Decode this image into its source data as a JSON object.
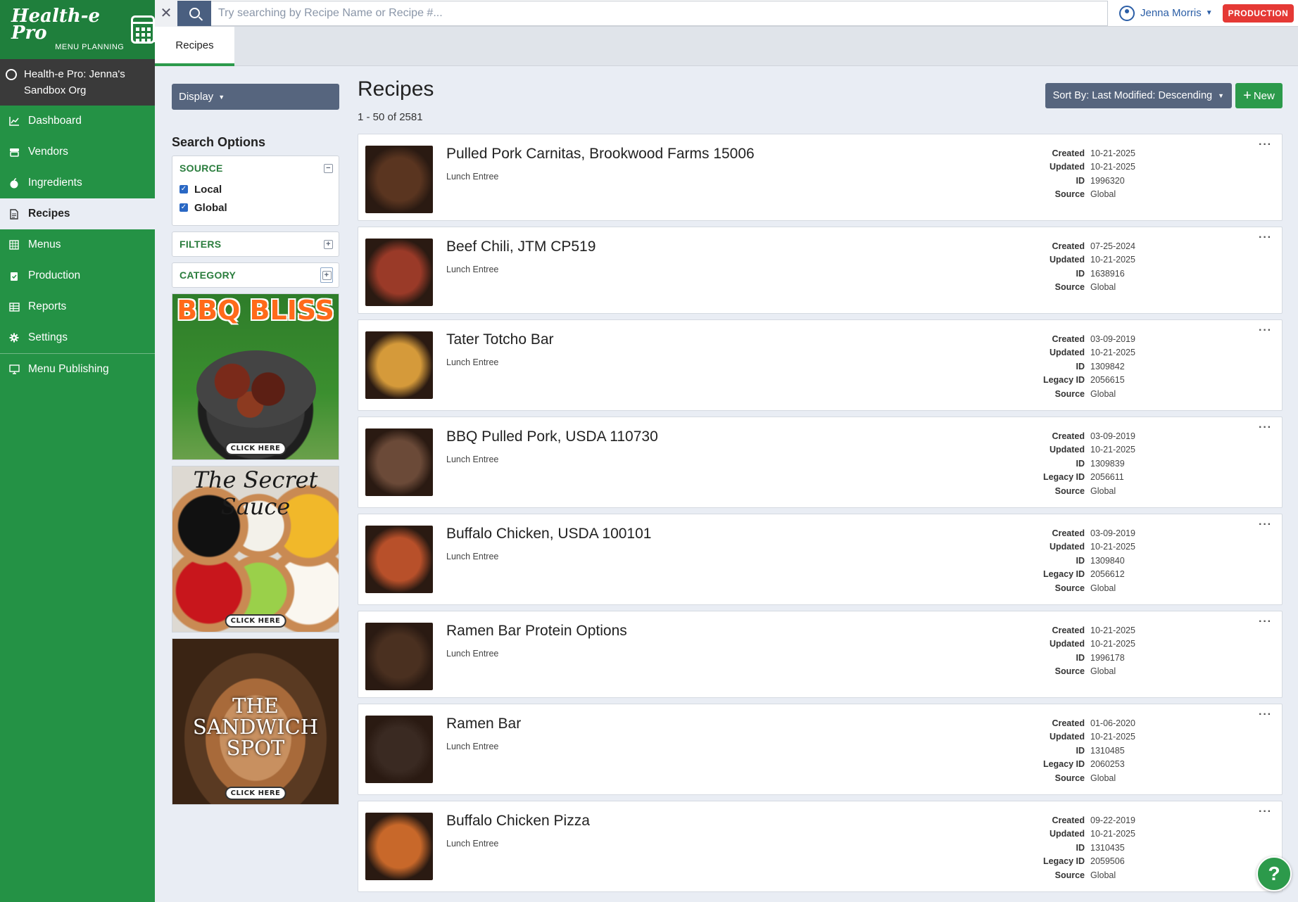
{
  "app": {
    "logo_title": "Health-e Pro",
    "logo_subtitle": "MENU PLANNING",
    "org_name": "Health-e Pro: Jenna's Sandbox Org"
  },
  "nav": [
    {
      "label": "Dashboard",
      "icon": "chart-line-icon",
      "active": false
    },
    {
      "label": "Vendors",
      "icon": "truck-icon",
      "active": false
    },
    {
      "label": "Ingredients",
      "icon": "apple-icon",
      "active": false
    },
    {
      "label": "Recipes",
      "icon": "document-icon",
      "active": true
    },
    {
      "label": "Menus",
      "icon": "calendar-icon",
      "active": false
    },
    {
      "label": "Production",
      "icon": "clipboard-check-icon",
      "active": false
    },
    {
      "label": "Reports",
      "icon": "table-icon",
      "active": false
    },
    {
      "label": "Settings",
      "icon": "gear-icon",
      "active": false
    },
    {
      "label": "Menu Publishing",
      "icon": "monitor-icon",
      "active": false
    }
  ],
  "topbar": {
    "search_placeholder": "Try searching by Recipe Name or Recipe #...",
    "user_name": "Jenna Morris",
    "env_badge": "PRODUCTION"
  },
  "tabs": [
    {
      "label": "Recipes"
    }
  ],
  "left": {
    "display_label": "Display",
    "search_options_title": "Search Options",
    "source_title": "SOURCE",
    "source_options": [
      {
        "label": "Local",
        "checked": true
      },
      {
        "label": "Global",
        "checked": true
      }
    ],
    "filters_title": "FILTERS",
    "category_title": "CATEGORY",
    "ads": [
      {
        "title": "BBQ BLISS",
        "cta": "CLICK HERE"
      },
      {
        "title": "The Secret Sauce",
        "cta": "CLICK HERE"
      },
      {
        "title": "THE SANDWICH SPOT",
        "cta": "CLICK HERE"
      }
    ]
  },
  "main": {
    "title": "Recipes",
    "count_text": "1 - 50 of 2581",
    "sort_label": "Sort By: Last Modified: Descending",
    "new_label": "New"
  },
  "recipes": [
    {
      "name": "Pulled Pork Carnitas, Brookwood Farms 15006",
      "category": "Lunch Entree",
      "meta": [
        {
          "k": "Created",
          "v": "10-21-2025"
        },
        {
          "k": "Updated",
          "v": "10-21-2025"
        },
        {
          "k": "ID",
          "v": "1996320"
        },
        {
          "k": "Source",
          "v": "Global"
        }
      ],
      "thumb_color": "#5a3520"
    },
    {
      "name": "Beef Chili, JTM CP519",
      "category": "Lunch Entree",
      "meta": [
        {
          "k": "Created",
          "v": "07-25-2024"
        },
        {
          "k": "Updated",
          "v": "10-21-2025"
        },
        {
          "k": "ID",
          "v": "1638916"
        },
        {
          "k": "Source",
          "v": "Global"
        }
      ],
      "thumb_color": "#9a3a28"
    },
    {
      "name": "Tater Totcho Bar",
      "category": "Lunch Entree",
      "meta": [
        {
          "k": "Created",
          "v": "03-09-2019"
        },
        {
          "k": "Updated",
          "v": "10-21-2025"
        },
        {
          "k": "ID",
          "v": "1309842"
        },
        {
          "k": "Legacy ID",
          "v": "2056615"
        },
        {
          "k": "Source",
          "v": "Global"
        }
      ],
      "thumb_color": "#d59a3a"
    },
    {
      "name": "BBQ Pulled Pork, USDA 110730",
      "category": "Lunch Entree",
      "meta": [
        {
          "k": "Created",
          "v": "03-09-2019"
        },
        {
          "k": "Updated",
          "v": "10-21-2025"
        },
        {
          "k": "ID",
          "v": "1309839"
        },
        {
          "k": "Legacy ID",
          "v": "2056611"
        },
        {
          "k": "Source",
          "v": "Global"
        }
      ],
      "thumb_color": "#6b4a38"
    },
    {
      "name": "Buffalo Chicken, USDA 100101",
      "category": "Lunch Entree",
      "meta": [
        {
          "k": "Created",
          "v": "03-09-2019"
        },
        {
          "k": "Updated",
          "v": "10-21-2025"
        },
        {
          "k": "ID",
          "v": "1309840"
        },
        {
          "k": "Legacy ID",
          "v": "2056612"
        },
        {
          "k": "Source",
          "v": "Global"
        }
      ],
      "thumb_color": "#b8502a"
    },
    {
      "name": "Ramen Bar Protein Options",
      "category": "Lunch Entree",
      "meta": [
        {
          "k": "Created",
          "v": "10-21-2025"
        },
        {
          "k": "Updated",
          "v": "10-21-2025"
        },
        {
          "k": "ID",
          "v": "1996178"
        },
        {
          "k": "Source",
          "v": "Global"
        }
      ],
      "thumb_color": "#4a3020"
    },
    {
      "name": "Ramen Bar",
      "category": "Lunch Entree",
      "meta": [
        {
          "k": "Created",
          "v": "01-06-2020"
        },
        {
          "k": "Updated",
          "v": "10-21-2025"
        },
        {
          "k": "ID",
          "v": "1310485"
        },
        {
          "k": "Legacy ID",
          "v": "2060253"
        },
        {
          "k": "Source",
          "v": "Global"
        }
      ],
      "thumb_color": "#3a2a22"
    },
    {
      "name": "Buffalo Chicken Pizza",
      "category": "Lunch Entree",
      "meta": [
        {
          "k": "Created",
          "v": "09-22-2019"
        },
        {
          "k": "Updated",
          "v": "10-21-2025"
        },
        {
          "k": "ID",
          "v": "1310435"
        },
        {
          "k": "Legacy ID",
          "v": "2059506"
        },
        {
          "k": "Source",
          "v": "Global"
        }
      ],
      "thumb_color": "#c8682a"
    }
  ],
  "help_label": "?"
}
